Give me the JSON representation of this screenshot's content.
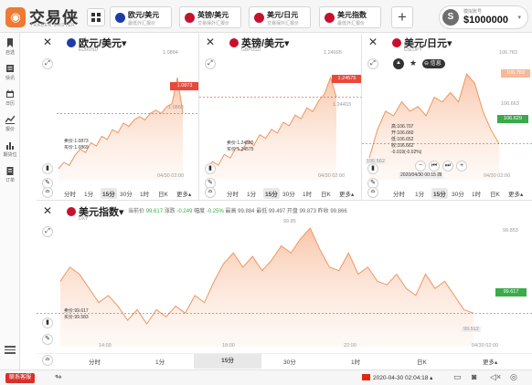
{
  "brand": {
    "name": "交易侠",
    "sub": "TRADER MASTER"
  },
  "tabs": [
    {
      "name": "欧元/美元",
      "sub": "最低外汇报价",
      "flag": "#1e3ca8"
    },
    {
      "name": "英镑/美元",
      "sub": "交易保外汇报价",
      "flag": "#c8102e"
    },
    {
      "name": "美元/日元",
      "sub": "交易保外汇报价",
      "flag": "#c8102e"
    },
    {
      "name": "美元指数",
      "sub": "最低外汇报价",
      "flag": "#c8102e"
    }
  ],
  "account": {
    "label": "模拟账号",
    "balance": "$1000000"
  },
  "sidebar": [
    {
      "label": "自选",
      "icon": "bookmark-icon"
    },
    {
      "label": "快讯",
      "icon": "news-icon"
    },
    {
      "label": "日历",
      "icon": "calendar-icon"
    },
    {
      "label": "报价",
      "icon": "quote-chart-icon"
    },
    {
      "label": "期货位",
      "icon": "bar-chart-icon"
    },
    {
      "label": "订单",
      "icon": "clipboard-icon"
    }
  ],
  "timeframes": [
    "分时",
    "1分",
    "15分",
    "30分",
    "1时",
    "日K",
    "更多▴"
  ],
  "timeframes_wide": [
    "分时",
    "1分",
    "15分",
    "30分",
    "1时",
    "日K",
    "更多▴"
  ],
  "panels": [
    {
      "title": "欧元/美元▾",
      "code": "EURUSD",
      "flag": "#1e3ca8",
      "high_label": "1.0884",
      "mid_label": "1.0863",
      "tag": "1.0873",
      "tag_color": "#e8493a",
      "bid": "卖价:1.0873",
      "ask": "买价:1.0869",
      "time": "04/30 02:00"
    },
    {
      "title": "英镑/美元▾",
      "code": "GBPUSD",
      "flag": "#c8102e",
      "high_label": "1.24695",
      "mid_label": "1.24403",
      "tag": "1.24575",
      "tag_color": "#e8493a",
      "bid": "卖价:1.24580",
      "ask": "买价:1.24575",
      "time": "04/30 02:00"
    },
    {
      "title": "美元/日元▾",
      "code": "USDJPY",
      "flag": "#c8102e",
      "high_label": "106.783",
      "top_tag": "106.783",
      "mid_label": "106.663",
      "tag": "106.629",
      "tag_color": "#3aaa4a",
      "low_label": "106.562",
      "info": [
        "高:106.707",
        "开:106.660",
        "低:106.652",
        "收:106.662",
        "-0.019(-0.02%)"
      ],
      "info_time": "2020/04/30 00:15 四",
      "badge": "信息",
      "time": "04/30 02:00"
    }
  ],
  "index_panel": {
    "title": "美元指数▾",
    "code": "DXY",
    "stats": {
      "current_label": "当前价",
      "current": "99.617",
      "change_label": "涨跌",
      "change": "-0.249",
      "pct_label": "幅度",
      "pct": "-0.25%",
      "high_label": "最高",
      "high": "99.884",
      "low_label": "最低",
      "low": "99.497",
      "open_label": "开盘",
      "open": "99.873",
      "prev_label": "昨收",
      "prev": "99.866"
    },
    "top_label": "99.853",
    "peak": "99.85",
    "tag": "99.617",
    "tag_color": "#3aaa4a",
    "bid": "卖价:99.617",
    "ask": "买价:99.583",
    "low_tag": "99.512",
    "x_labels": [
      "14:00",
      "18:00",
      "22:00"
    ],
    "time": "04/30 02:00"
  },
  "bottom": {
    "support": "联系客服",
    "datetime": "2020-04-30 02:04:18 ▴"
  },
  "chart_data": [
    {
      "type": "area",
      "title": "欧元/美元",
      "series": [
        {
          "values": [
            1.0856,
            1.0858,
            1.0857,
            1.086,
            1.0862,
            1.0861,
            1.0864,
            1.0863,
            1.0866,
            1.0865,
            1.0868,
            1.0867,
            1.087,
            1.0869,
            1.0871,
            1.0872,
            1.0871,
            1.0873,
            1.0874,
            1.0873,
            1.0875,
            1.0876,
            1.0884,
            1.0873
          ]
        }
      ]
    },
    {
      "type": "area",
      "title": "英镑/美元",
      "series": [
        {
          "values": [
            1.2418,
            1.2422,
            1.242,
            1.2426,
            1.2424,
            1.243,
            1.2428,
            1.2434,
            1.2431,
            1.2437,
            1.2435,
            1.244,
            1.2438,
            1.2444,
            1.2442,
            1.2448,
            1.2446,
            1.2452,
            1.245,
            1.2456,
            1.246,
            1.2469,
            1.2458
          ]
        }
      ]
    },
    {
      "type": "area",
      "title": "美元/日元",
      "series": [
        {
          "values": [
            106.6,
            106.66,
            106.7,
            106.69,
            106.72,
            106.7,
            106.71,
            106.69,
            106.73,
            106.72,
            106.74,
            106.72,
            106.78,
            106.76,
            106.7,
            106.66,
            106.63
          ]
        }
      ]
    },
    {
      "type": "area",
      "title": "美元指数",
      "series": [
        {
          "values": [
            99.7,
            99.74,
            99.72,
            99.68,
            99.64,
            99.66,
            99.63,
            99.59,
            99.62,
            99.58,
            99.62,
            99.6,
            99.63,
            99.61,
            99.66,
            99.64,
            99.7,
            99.75,
            99.78,
            99.74,
            99.77,
            99.73,
            99.76,
            99.8,
            99.78,
            99.82,
            99.85,
            99.79,
            99.74,
            99.73,
            99.78,
            99.72,
            99.74,
            99.7,
            99.69,
            99.72,
            99.68,
            99.66,
            99.72,
            99.68,
            99.7,
            99.66,
            99.62,
            99.61
          ]
        }
      ]
    }
  ]
}
